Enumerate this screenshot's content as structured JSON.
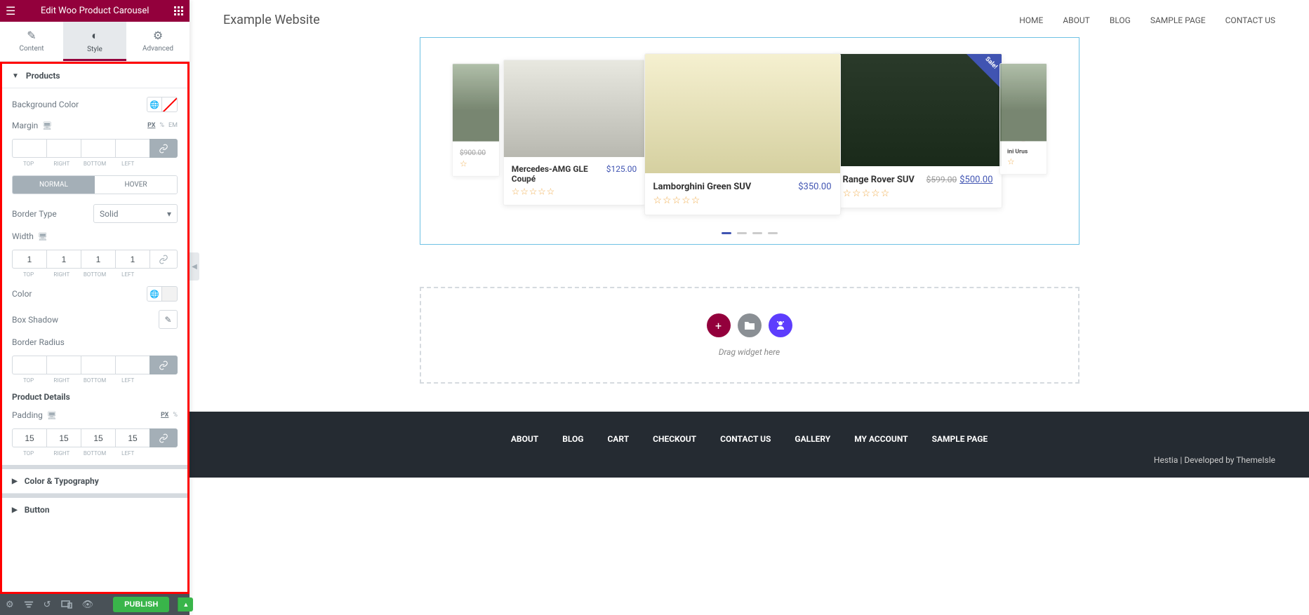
{
  "editor": {
    "header_title": "Edit Woo Product Carousel",
    "tabs": {
      "content": "Content",
      "style": "Style",
      "advanced": "Advanced"
    },
    "sections": {
      "products": "Products",
      "color_typo": "Color & Typography",
      "button": "Button"
    },
    "controls": {
      "bg_color": "Background Color",
      "margin": "Margin",
      "normal": "NORMAL",
      "hover": "HOVER",
      "border_type": "Border Type",
      "border_type_value": "Solid",
      "width": "Width",
      "width_vals": {
        "top": "1",
        "right": "1",
        "bottom": "1",
        "left": "1"
      },
      "color": "Color",
      "box_shadow": "Box Shadow",
      "border_radius": "Border Radius",
      "product_details": "Product Details",
      "padding": "Padding",
      "padding_vals": {
        "top": "15",
        "right": "15",
        "bottom": "15",
        "left": "15"
      },
      "dim_labels": {
        "top": "TOP",
        "right": "RIGHT",
        "bottom": "BOTTOM",
        "left": "LEFT"
      },
      "units": {
        "px": "PX",
        "pct": "%",
        "em": "EM"
      }
    },
    "footer": {
      "publish": "PUBLISH"
    }
  },
  "site": {
    "title": "Example Website",
    "nav": [
      "HOME",
      "ABOUT",
      "BLOG",
      "SAMPLE PAGE",
      "CONTACT US"
    ]
  },
  "carousel": {
    "items": [
      {
        "name": "",
        "price": "",
        "old": "$900.00"
      },
      {
        "name": "Mercedes-AMG GLE Coupé",
        "price": "$125.00"
      },
      {
        "name": "Lamborghini Green SUV",
        "price": "$350.00"
      },
      {
        "name": "Range Rover SUV",
        "price": "$500.00",
        "old": "$599.00",
        "sale": "Sale!"
      },
      {
        "name": "ini Urus",
        "price": ""
      }
    ]
  },
  "empty": {
    "text": "Drag widget here"
  },
  "footer": {
    "nav": [
      "ABOUT",
      "BLOG",
      "CART",
      "CHECKOUT",
      "CONTACT US",
      "GALLERY",
      "MY ACCOUNT",
      "SAMPLE PAGE"
    ],
    "credit_prefix": "Hestia | Developed by ",
    "credit_link": "ThemeIsle"
  }
}
